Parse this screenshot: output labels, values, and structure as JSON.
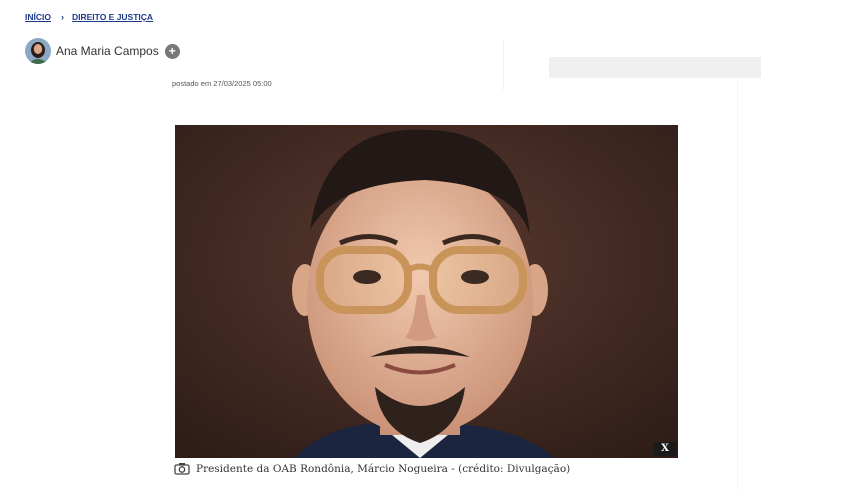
{
  "breadcrumb": {
    "home": "INÍCIO",
    "separator": "›",
    "section": "DIREITO E JUSTIÇA"
  },
  "author": {
    "name": "Ana Maria Campos",
    "follow_label": "+"
  },
  "post": {
    "posted_at": "postado em 27/03/2025 05:00"
  },
  "image": {
    "close_label": "X",
    "caption": "Presidente da OAB Rondônia, Márcio Nogueira - (crédito: Divulgação)"
  },
  "icons": {
    "camera": "camera-icon",
    "chevron": "chevron-right-icon",
    "avatar": "author-avatar"
  },
  "colors": {
    "link": "#1b3a8c",
    "photo_background": "#3c2620"
  }
}
